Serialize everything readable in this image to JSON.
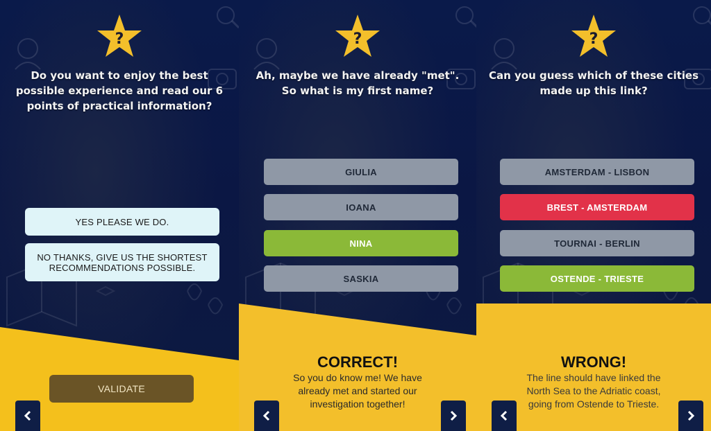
{
  "panel1": {
    "question": "Do you want to enjoy the best possible experience and read our 6 points of practical information?",
    "option_yes": "YES PLEASE WE DO.",
    "option_no": "NO THANKS, GIVE US THE SHORTEST RECOMMENDATIONS POSSIBLE.",
    "validate_label": "VALIDATE",
    "back_icon": "chevron-left-icon"
  },
  "panel2": {
    "question": "Ah, maybe we have already \"met\". So what is my first name?",
    "answers": [
      "GIULIA",
      "IOANA",
      "NINA",
      "SASKIA"
    ],
    "result_title": "CORRECT!",
    "result_text": "So you do know me! We have already met and started our investigation together!",
    "back_icon": "chevron-left-icon",
    "next_icon": "chevron-right-icon"
  },
  "panel3": {
    "question": "Can you guess which of these cities made up this link?",
    "answers": [
      "AMSTERDAM - LISBON",
      "BREST - AMSTERDAM",
      "TOURNAI - BERLIN",
      "OSTENDE - TRIESTE"
    ],
    "result_title": "WRONG!",
    "result_text": "The line should have linked the North Sea to the Adriatic coast, going from Ostende to Trieste.",
    "back_icon": "chevron-left-icon",
    "next_icon": "chevron-right-icon"
  },
  "colors": {
    "star": "#f3bf2b",
    "correct": "#8bb938",
    "wrong": "#e23249",
    "neutral": "#8f98a6",
    "panel_bg": "#0b1744",
    "yellow": "#f3bf2b"
  }
}
